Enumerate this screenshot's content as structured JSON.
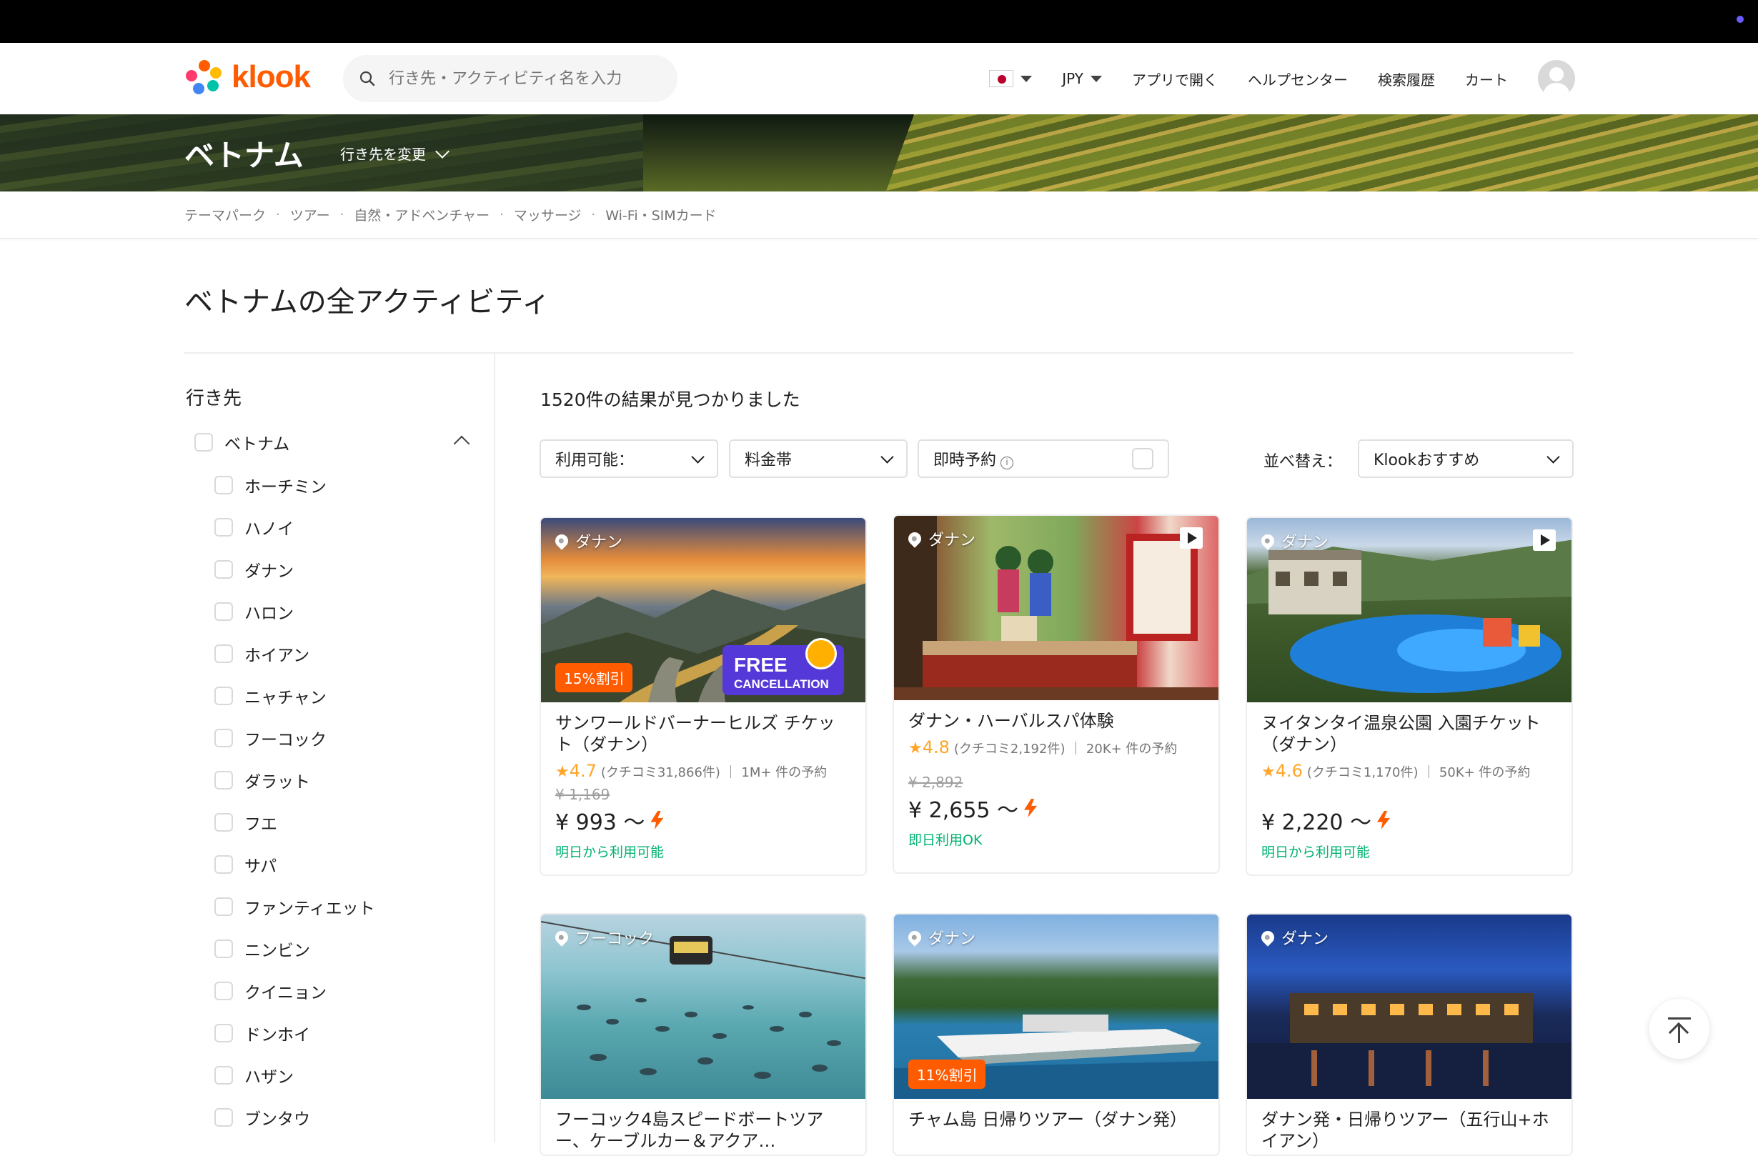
{
  "header": {
    "logo_text": "klook",
    "search_placeholder": "行き先・アクティビティ名を入力",
    "currency": "JPY",
    "nav": [
      "アプリで開く",
      "ヘルプセンター",
      "検索履歴",
      "カート"
    ]
  },
  "banner": {
    "title": "ベトナム",
    "change_destination": "行き先を変更"
  },
  "breadcrumbs": [
    "テーマパーク",
    "ツアー",
    "自然・アドベンチャー",
    "マッサージ",
    "Wi-Fi・SIMカード"
  ],
  "page_title": "ベトナムの全アクティビティ",
  "sidebar": {
    "heading": "行き先",
    "parent": "ベトナム",
    "children": [
      "ホーチミン",
      "ハノイ",
      "ダナン",
      "ハロン",
      "ホイアン",
      "ニャチャン",
      "フーコック",
      "ダラット",
      "フエ",
      "サパ",
      "ファンティエット",
      "ニンビン",
      "クイニョン",
      "ドンホイ",
      "ハザン",
      "ブンタウ"
    ]
  },
  "results_text": "1520件の結果が見つかりました",
  "filters": {
    "availability": "利用可能：",
    "price_range": "料金帯",
    "instant_booking": "即時予約",
    "sort_label": "並べ替え：",
    "sort_value": "Klookおすすめ"
  },
  "cards": [
    {
      "location": "ダナン",
      "badge": "15%割引",
      "free_cancel_1": "FREE",
      "free_cancel_2": "CANCELLATION",
      "title": "サンワールドバーナーヒルズ チケット（ダナン）",
      "score": "4.7",
      "reviews": "(クチコミ31,866件) ｜ 1M+ 件の予約",
      "old_price": "¥ 1,169",
      "price": "¥ 993 ～",
      "availability": "明日から利用可能"
    },
    {
      "location": "ダナン",
      "title": "ダナン・ハーバルスパ体験",
      "score": "4.8",
      "reviews": "(クチコミ2,192件) ｜ 20K+ 件の予約",
      "old_price": "¥ 2,892",
      "price": "¥ 2,655 ～",
      "availability": "即日利用OK"
    },
    {
      "location": "ダナン",
      "title": "ヌイタンタイ温泉公園 入園チケット（ダナン）",
      "score": "4.6",
      "reviews": "(クチコミ1,170件) ｜ 50K+ 件の予約",
      "price": "¥ 2,220 ～",
      "availability": "明日から利用可能"
    },
    {
      "location": "フーコック",
      "title": "フーコック4島スピードボートツアー、ケーブルカー＆アクア…"
    },
    {
      "location": "ダナン",
      "badge": "11%割引",
      "title": "チャム島 日帰りツアー（ダナン発）"
    },
    {
      "location": "ダナン",
      "title": "ダナン発・日帰りツアー（五行山+ホイアン）"
    }
  ],
  "colors": {
    "brand": "#ff5b00",
    "star": "#ffa628",
    "available": "#00b371",
    "free_cancel": "#5538d8"
  },
  "icons": [
    "search-icon",
    "flag-japan-icon",
    "chevron-down-icon",
    "avatar-icon",
    "location-pin-icon",
    "play-icon",
    "star-icon",
    "bolt-icon",
    "back-to-top-icon",
    "info-icon"
  ]
}
